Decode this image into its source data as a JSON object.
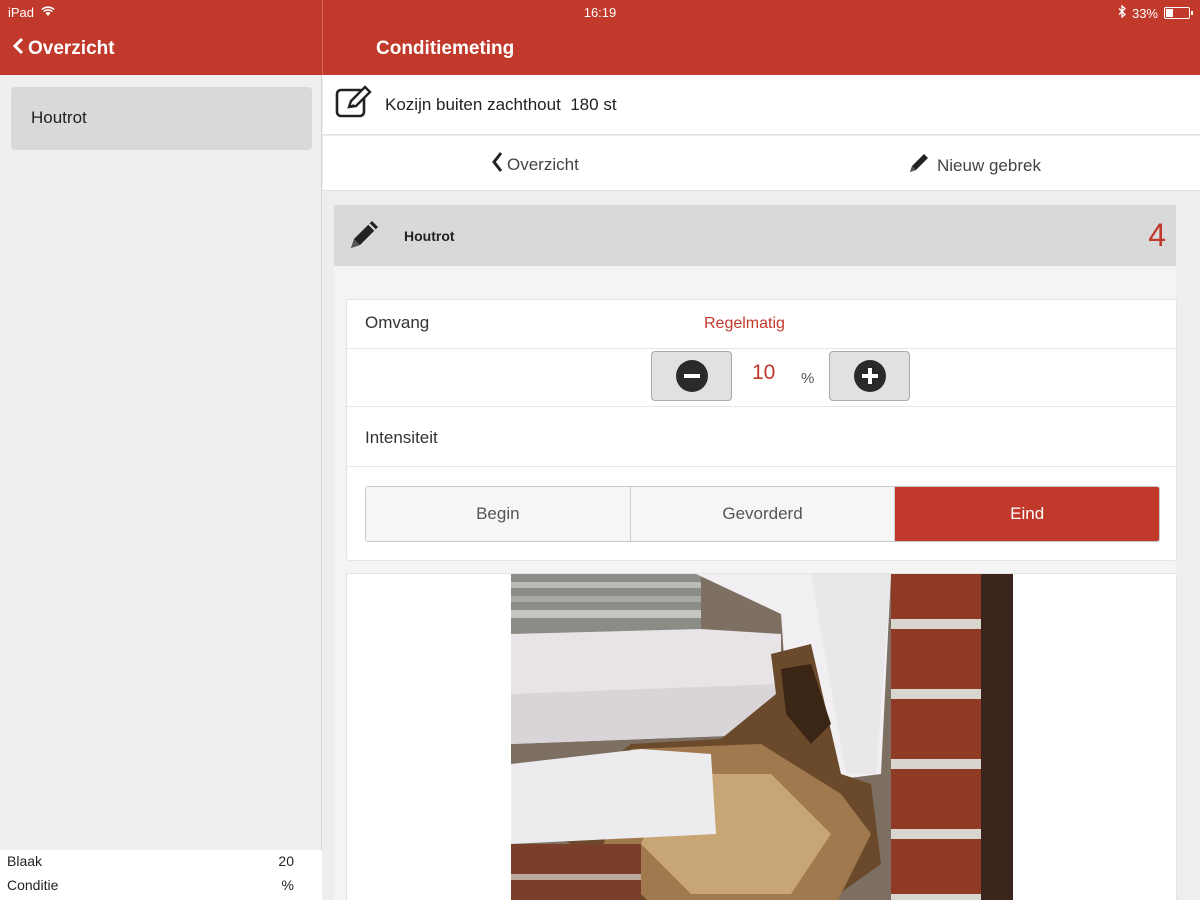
{
  "status": {
    "device": "iPad",
    "time": "16:19",
    "battery": "33%",
    "battery_level": 0.33
  },
  "nav": {
    "back_label": "Overzicht",
    "title": "Conditiemeting"
  },
  "sidebar": {
    "items": [
      {
        "label": "Houtrot"
      }
    ],
    "footer": [
      {
        "label": "Blaak",
        "value": "20"
      },
      {
        "label": "Conditie",
        "value": "%"
      }
    ]
  },
  "object": {
    "name": "Kozijn buiten zachthout  180 st"
  },
  "subnav": {
    "back_label": "Overzicht",
    "new_label": "Nieuw gebrek"
  },
  "defect": {
    "title": "Houtrot",
    "number": "4",
    "omvang_label": "Omvang",
    "omvang_value": "Regelmatig",
    "percentage": "10",
    "unit": "%",
    "intensiteit_label": "Intensiteit",
    "intensity_options": [
      "Begin",
      "Gevorderd",
      "Eind"
    ],
    "selected_intensity": "Eind"
  },
  "colors": {
    "accent": "#c0392b"
  },
  "icons": {
    "edit": "edit-square-icon",
    "pencil": "pencil-icon",
    "back": "chevron-left-icon",
    "minus": "minus-circle-icon",
    "plus": "plus-circle-icon"
  }
}
